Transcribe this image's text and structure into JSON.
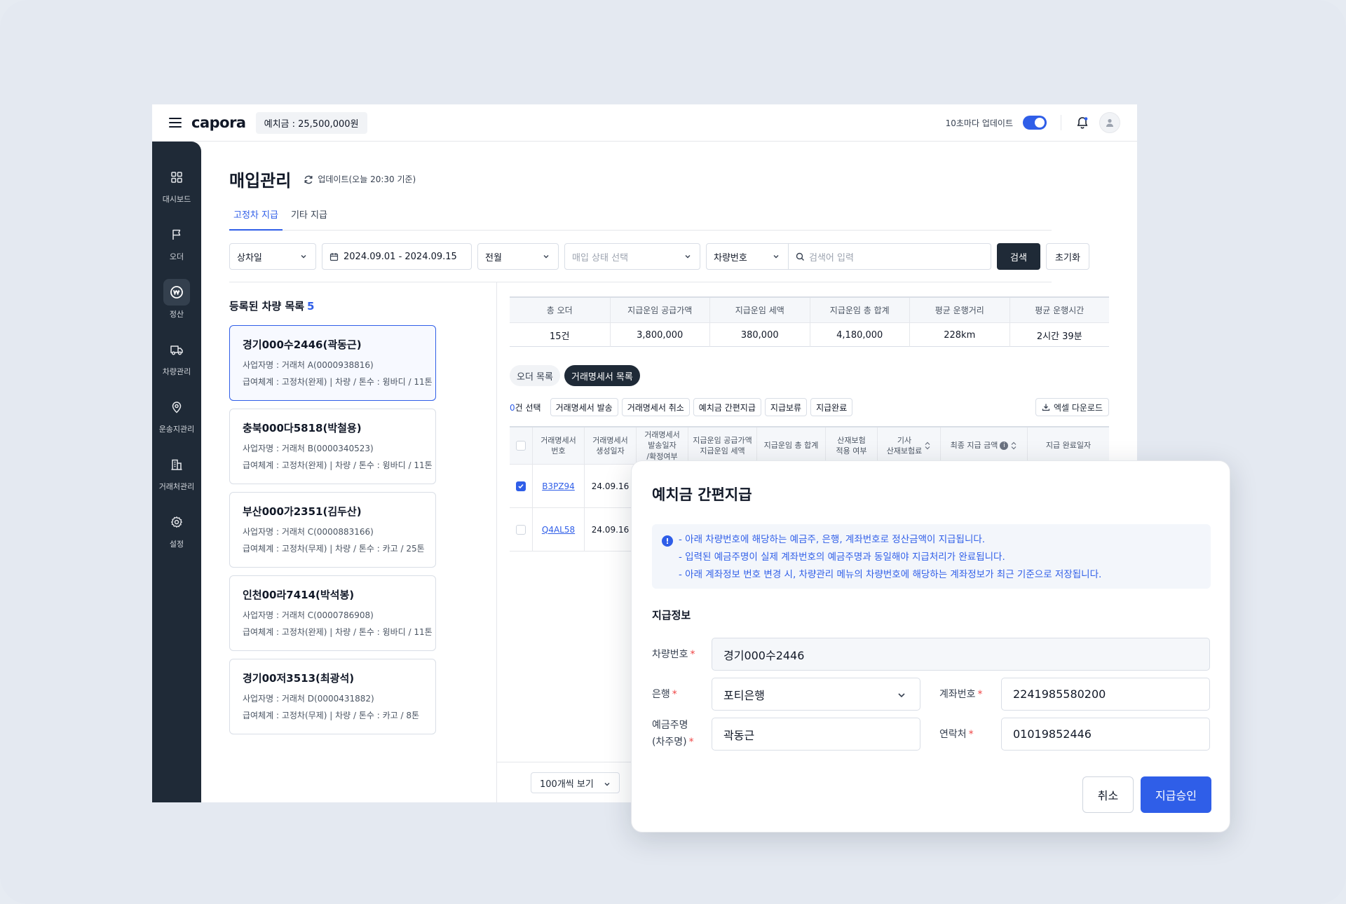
{
  "header": {
    "logo": "capora",
    "deposit": "예치금 : 25,500,000원",
    "auto_update_label": "10초마다 업데이트"
  },
  "sidebar": {
    "items": [
      {
        "label": "대시보드",
        "icon": "grid-icon"
      },
      {
        "label": "오더",
        "icon": "flag-icon"
      },
      {
        "label": "정산",
        "icon": "won-icon"
      },
      {
        "label": "차량관리",
        "icon": "truck-icon"
      },
      {
        "label": "운송지관리",
        "icon": "location-pin-icon"
      },
      {
        "label": "거래처관리",
        "icon": "building-icon"
      },
      {
        "label": "설정",
        "icon": "gear-icon"
      }
    ],
    "active_index": 2
  },
  "page": {
    "title": "매입관리",
    "refresh_text": "업데이트(오늘 20:30 기준)",
    "tabs": [
      "고정차 지급",
      "기타 지급"
    ]
  },
  "filters": {
    "date_type": "상차일",
    "date_range": "2024.09.01 - 2024.09.15",
    "period": "전월",
    "status_placeholder": "매입 상태 선택",
    "search_type": "차량번호",
    "search_placeholder": "검색어 입력",
    "search_button": "검색",
    "reset_button": "초기화"
  },
  "vehicle_list": {
    "title": "등록된 차량 목록",
    "count": "5",
    "items": [
      {
        "name": "경기000수2446(곽동근)",
        "business": "사업자명 : 거래처 A(0000938816)",
        "info": "급여체계 : 고정차(완제)  |  차량 / 톤수 : 윙바디 / 11톤"
      },
      {
        "name": "충북000다5818(박철용)",
        "business": "사업자명 : 거래처 B(0000340523)",
        "info": "급여체계 : 고정차(완제)  |  차량 / 톤수 : 윙바디 / 11톤"
      },
      {
        "name": "부산000가2351(김두산)",
        "business": "사업자명 : 거래처 C(0000883166)",
        "info": "급여체계 : 고정차(무제)  |  차량 / 톤수 : 카고 / 25톤"
      },
      {
        "name": "인천00라7414(박석봉)",
        "business": "사업자명 : 거래처 C(0000786908)",
        "info": "급여체계 : 고정차(완제)  |  차량 / 톤수 : 윙바디 / 11톤"
      },
      {
        "name": "경기00저3513(최광석)",
        "business": "사업자명 : 거래처 D(0000431882)",
        "info": "급여체계 : 고정차(무제)  |  차량 / 톤수 : 카고 / 8톤"
      }
    ]
  },
  "summary": {
    "headers": [
      "총 오더",
      "지급운임 공급가액",
      "지급운임 세액",
      "지급운임 총 합계",
      "평균 운행거리",
      "평균 운행시간"
    ],
    "values": [
      "15건",
      "3,800,000",
      "380,000",
      "4,180,000",
      "228km",
      "2시간 39분"
    ]
  },
  "subtabs": [
    "오더 목록",
    "거래명세서 목록"
  ],
  "actions": {
    "selected_count": "0",
    "selected_suffix": "건 선택",
    "buttons": [
      "거래명세서 발송",
      "거래명세서 취소",
      "예치금 간편지급",
      "지급보류",
      "지급완료"
    ],
    "excel": "엑셀 다운로드"
  },
  "table": {
    "headers": [
      "거래명세서\n번호",
      "거래명세서\n생성일자",
      "거래명세서\n발송일자\n/확정여부",
      "지급운임 공급가액\n지급운임 세액",
      "지급운임 총 합계",
      "산재보험\n적용 여부",
      "기사\n산재보험료",
      "최종 지급 금액",
      "지급 완료일자"
    ],
    "rows": [
      {
        "checked": true,
        "number": "B3PZ94",
        "date": "24.09.16"
      },
      {
        "checked": false,
        "number": "Q4AL58",
        "date": "24.09.16"
      }
    ]
  },
  "pagination": {
    "page_size": "100개씩 보기"
  },
  "modal": {
    "title": "예치금 간편지급",
    "notices": [
      "- 아래 차량번호에 해당하는 예금주, 은행, 계좌번호로 정산금액이 지급됩니다.",
      "- 입력된 예금주명이 실제 계좌번호의 예금주명과 동일해야 지급처리가 완료됩니다.",
      "- 아래 계좌정보 번호 변경 시, 차량관리 메뉴의 차량번호에 해당하는 계좌정보가 최근 기준으로 저장됩니다."
    ],
    "section_title": "지급정보",
    "labels": {
      "vehicle": "차량번호",
      "bank": "은행",
      "account": "계좌번호",
      "holder_line1": "예금주명",
      "holder_line2": "(차주명)",
      "phone": "연락처",
      "required": "*"
    },
    "values": {
      "vehicle": "경기000수2446",
      "bank": "포티은행",
      "account": "2241985580200",
      "holder": "곽동근",
      "phone": "01019852446"
    },
    "cancel": "취소",
    "confirm": "지급승인"
  },
  "colors": {
    "accent": "#2f5ee8",
    "sidebar": "#1f2a37",
    "required": "#ef4444"
  }
}
